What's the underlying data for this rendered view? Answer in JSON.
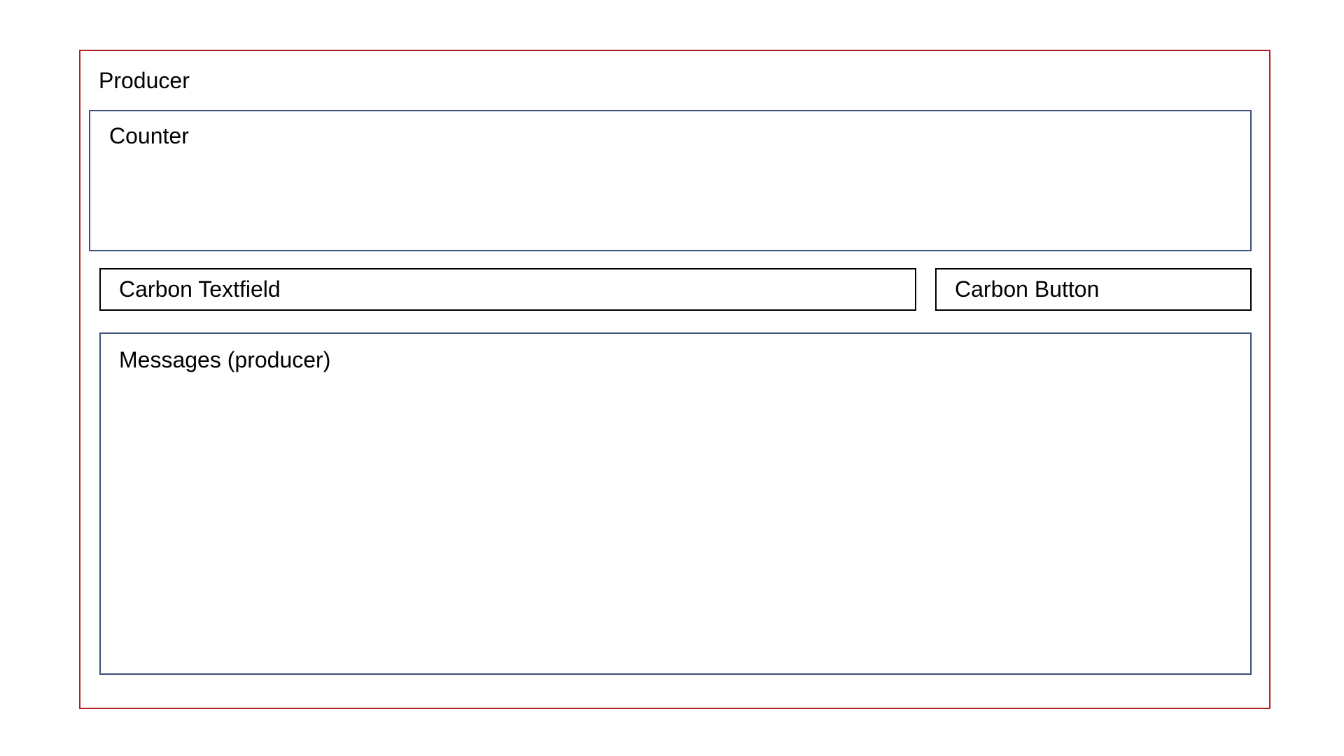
{
  "producer": {
    "label": "Producer",
    "border_color": "#b22222"
  },
  "counter": {
    "label": "Counter",
    "border_color": "#3b5278"
  },
  "textfield": {
    "label": "Carbon Textfield"
  },
  "button": {
    "label": "Carbon Button"
  },
  "messages": {
    "label": "Messages (producer)",
    "border_color": "#3b5278"
  }
}
